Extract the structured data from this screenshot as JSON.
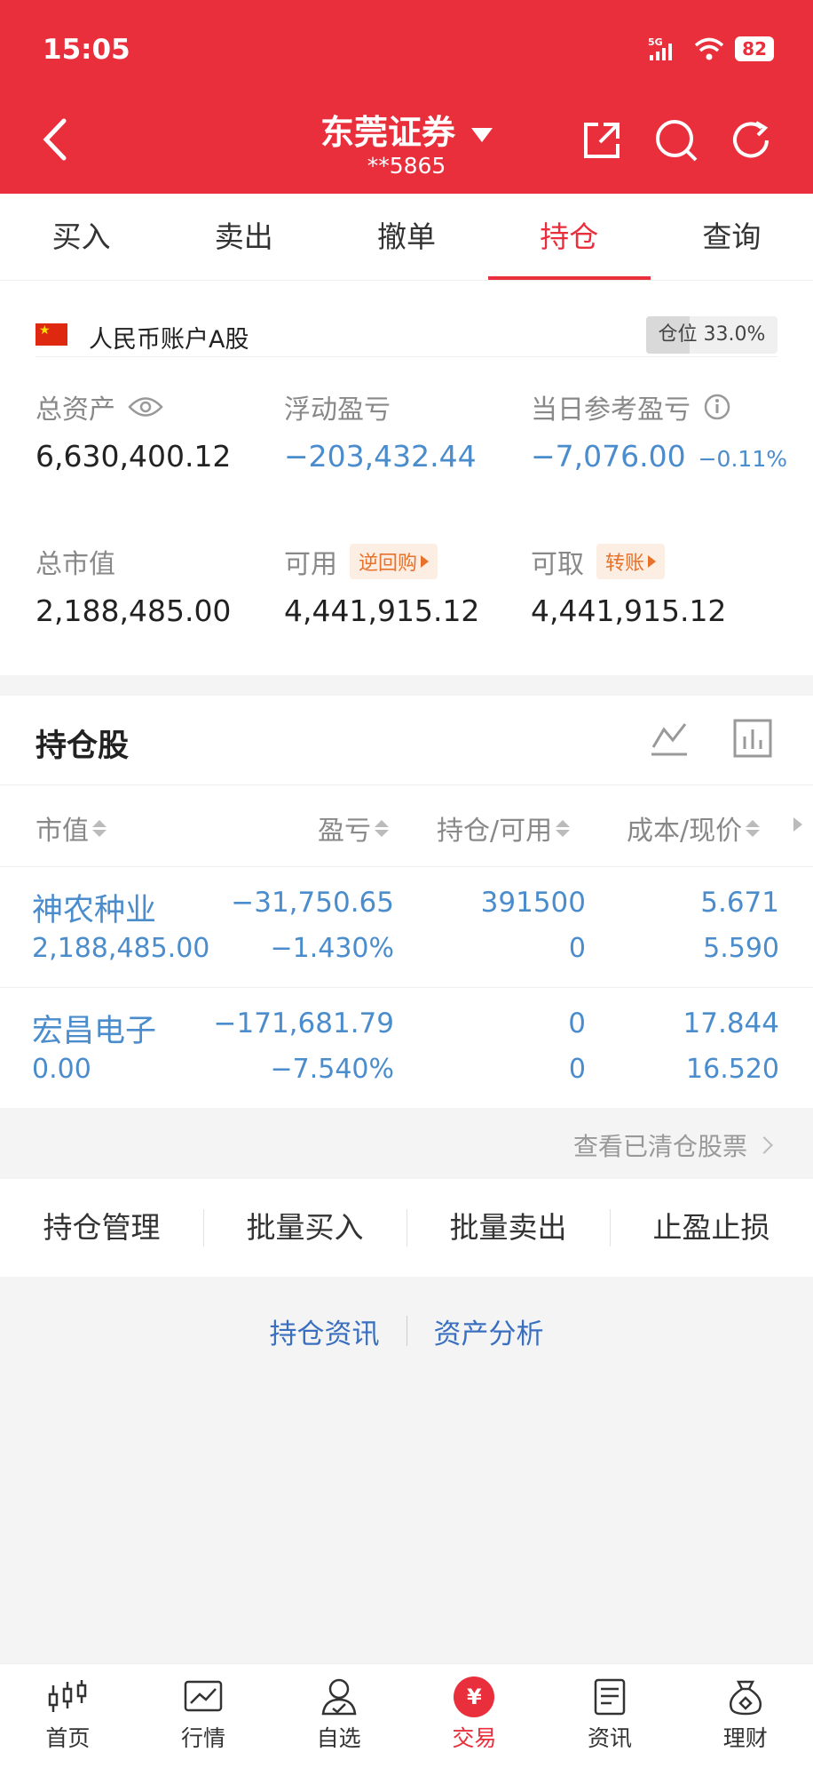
{
  "status_bar": {
    "time": "15:05",
    "network": "5G",
    "battery": "82"
  },
  "header": {
    "title": "东莞证券",
    "account_masked": "**5865"
  },
  "tabs": [
    {
      "label": "买入"
    },
    {
      "label": "卖出"
    },
    {
      "label": "撤单"
    },
    {
      "label": "持仓",
      "active": true
    },
    {
      "label": "查询"
    }
  ],
  "account": {
    "label": "人民币账户A股",
    "position_label": "仓位 33.0%",
    "position_fraction": 0.33
  },
  "metrics": {
    "total_assets_label": "总资产",
    "total_assets": "6,630,400.12",
    "floating_pl_label": "浮动盈亏",
    "floating_pl": "−203,432.44",
    "daily_pl_label": "当日参考盈亏",
    "daily_pl": "−7,076.00",
    "daily_pl_pct": "−0.11%",
    "market_value_label": "总市值",
    "market_value": "2,188,485.00",
    "available_label": "可用",
    "available": "4,441,915.12",
    "repo_tag": "逆回购",
    "withdrawable_label": "可取",
    "withdrawable": "4,441,915.12",
    "transfer_tag": "转账"
  },
  "holdings": {
    "title": "持仓股",
    "columns": {
      "market_value": "市值",
      "pl": "盈亏",
      "position": "持仓/可用",
      "cost": "成本/现价"
    },
    "rows": [
      {
        "name": "神农种业",
        "market_value": "2,188,485.00",
        "pl": "−31,750.65",
        "pl_pct": "−1.430%",
        "position": "391500",
        "available": "0",
        "cost": "5.671",
        "price": "5.590"
      },
      {
        "name": "宏昌电子",
        "market_value": "0.00",
        "pl": "−171,681.79",
        "pl_pct": "−7.540%",
        "position": "0",
        "available": "0",
        "cost": "17.844",
        "price": "16.520"
      }
    ],
    "cleared_link": "查看已清仓股票"
  },
  "actions": [
    {
      "label": "持仓管理"
    },
    {
      "label": "批量买入"
    },
    {
      "label": "批量卖出"
    },
    {
      "label": "止盈止损"
    }
  ],
  "links": {
    "holding_news": "持仓资讯",
    "asset_analysis": "资产分析"
  },
  "bottom_nav": [
    {
      "label": "首页"
    },
    {
      "label": "行情"
    },
    {
      "label": "自选"
    },
    {
      "label": "交易",
      "icon_text": "¥",
      "active": true
    },
    {
      "label": "资讯"
    },
    {
      "label": "理财"
    }
  ],
  "colors": {
    "brand_red": "#ea2f3c",
    "loss_blue": "#4a8ccc",
    "tag_orange": "#e8712b"
  }
}
